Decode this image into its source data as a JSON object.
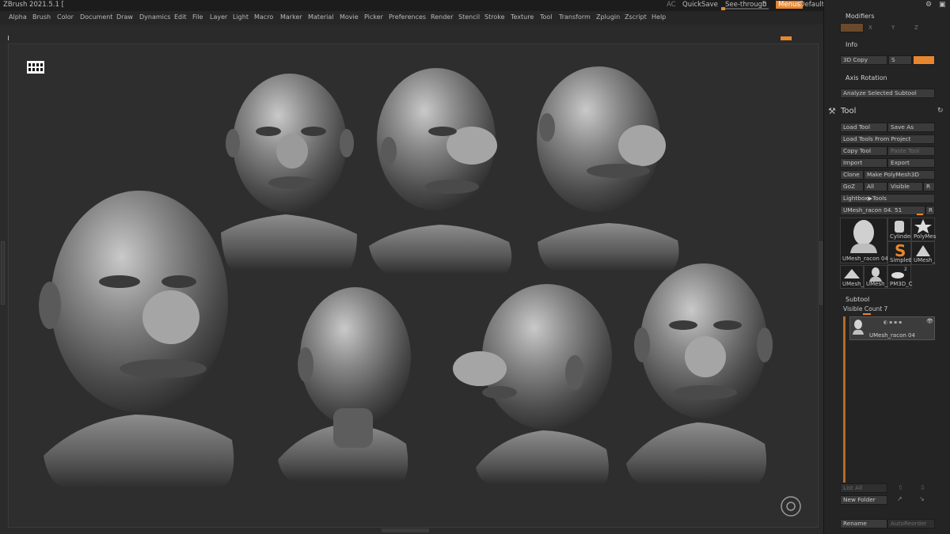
{
  "app": {
    "title": "ZBrush 2021.5.1 [",
    "ac": "AC",
    "quicksave": "QuickSave",
    "see_through_label": "See-through",
    "see_through_value": "0",
    "menus": "Menus",
    "script": "DefaultZScript"
  },
  "menu": [
    "Alpha",
    "Brush",
    "Color",
    "Document",
    "Draw",
    "Dynamics",
    "Edit",
    "File",
    "Layer",
    "Light",
    "Macro",
    "Marker",
    "Material",
    "Movie",
    "Picker",
    "Preferences",
    "Render",
    "Stencil",
    "Stroke",
    "Texture",
    "Tool",
    "Transform",
    "Zplugin",
    "Zscript",
    "Help"
  ],
  "panel": {
    "modifiers": {
      "title": "Modifiers",
      "xyz": [
        "X",
        "Y",
        "Z"
      ]
    },
    "info": {
      "title": "Info",
      "copy3d": "3D Copy",
      "s": "S"
    },
    "axis": {
      "title": "Axis Rotation",
      "analyze": "Analyze Selected Subtool"
    },
    "tool": {
      "title": "Tool",
      "load_tool": "Load Tool",
      "save_as": "Save As",
      "load_from_project": "Load Tools From Project",
      "copy_tool": "Copy Tool",
      "paste_tool": "Paste Tool",
      "import": "Import",
      "export": "Export",
      "clone": "Clone",
      "make_polymesh": "Make PolyMesh3D",
      "goz": "GoZ",
      "all": "All",
      "visible": "Visible",
      "r": "R",
      "lightbox": "Lightbox▶Tools",
      "current": "UMesh_racon 04. 51",
      "current_r": "R",
      "thumbs": {
        "main": "UMesh_racon 04",
        "cylinder": "Cylinder",
        "polymesh": "PolyMes",
        "simpleb": "SimpleB",
        "umesh": "UMesh_",
        "umesh2": "UMesh_",
        "umesh3": "UMesh_",
        "pm3d": "PM3D_C",
        "badge": "2"
      }
    },
    "subtool": {
      "title": "Subtool",
      "visible_count": "Visible Count 7",
      "item": "UMesh_racon 04",
      "list_all": "List All",
      "new_folder": "New Folder",
      "rename": "Rename",
      "autoreorder": "AutoReorder"
    }
  }
}
